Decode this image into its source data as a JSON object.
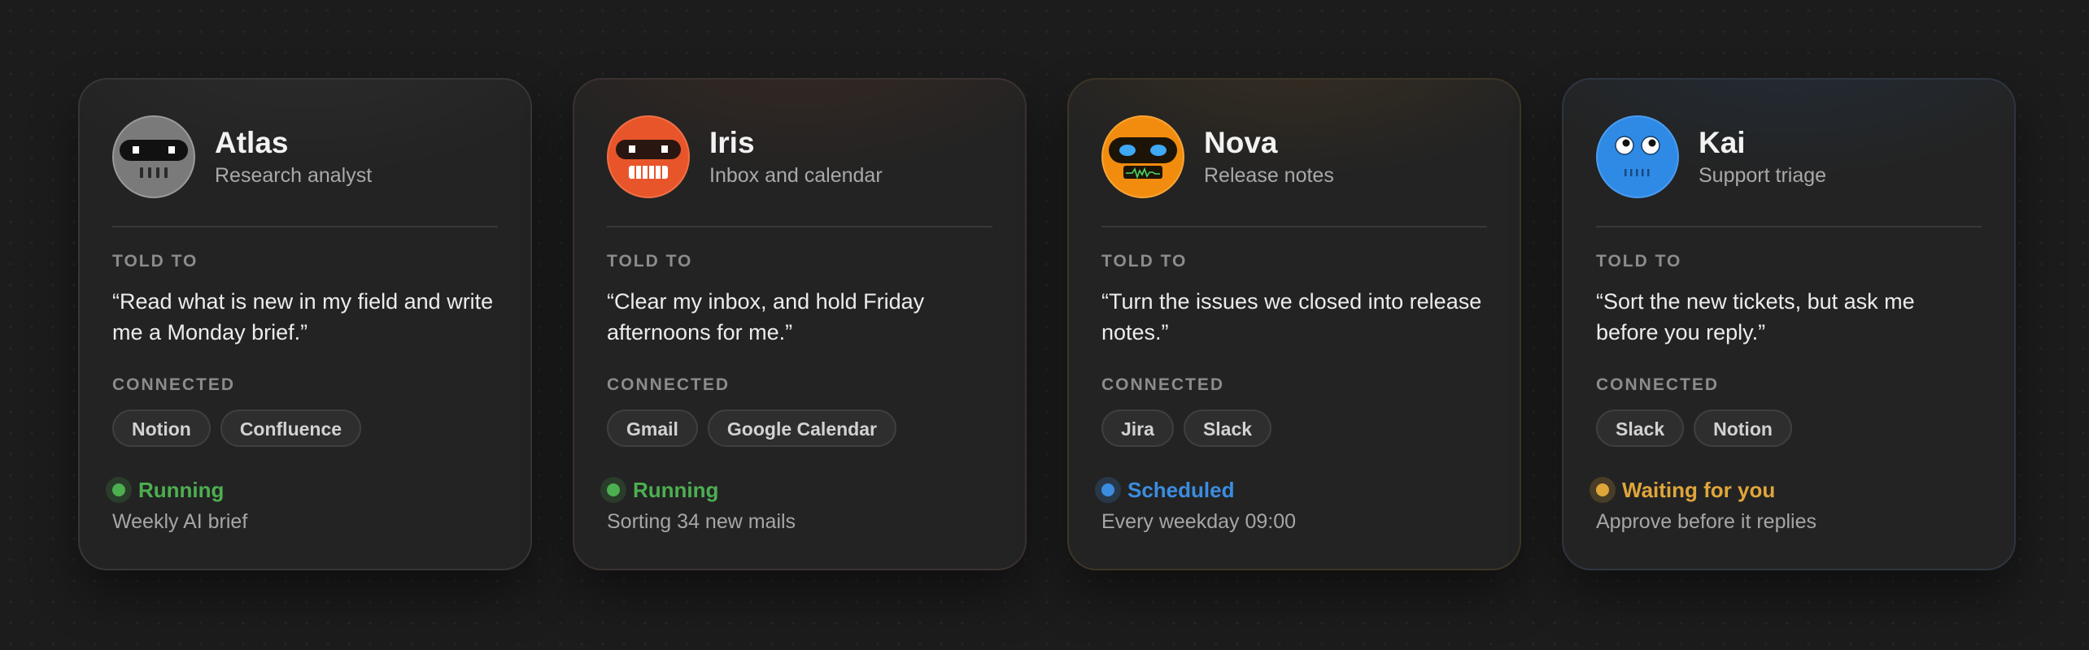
{
  "section_labels": {
    "told_to": "TOLD TO",
    "connected": "CONNECTED"
  },
  "agents": [
    {
      "name": "Atlas",
      "role": "Research analyst",
      "avatar": {
        "icon": "robot-visor-icon",
        "color": "#7a7a7a"
      },
      "instruction": "“Read what is new in my field and write me a Monday brief.”",
      "connected": [
        "Notion",
        "Confluence"
      ],
      "status": {
        "label": "Running",
        "color": "#4caf50"
      },
      "detail": "Weekly AI brief"
    },
    {
      "name": "Iris",
      "role": "Inbox and calendar",
      "avatar": {
        "icon": "robot-grin-icon",
        "color": "#e8552a"
      },
      "instruction": "“Clear my inbox, and hold Friday afternoons for me.”",
      "connected": [
        "Gmail",
        "Google Calendar"
      ],
      "status": {
        "label": "Running",
        "color": "#4caf50"
      },
      "detail": "Sorting 34 new mails"
    },
    {
      "name": "Nova",
      "role": "Release notes",
      "avatar": {
        "icon": "robot-pulse-icon",
        "color": "#f28c0f"
      },
      "instruction": "“Turn the issues we closed into release notes.”",
      "connected": [
        "Jira",
        "Slack"
      ],
      "status": {
        "label": "Scheduled",
        "color": "#3b8de0"
      },
      "detail": "Every weekday 09:00"
    },
    {
      "name": "Kai",
      "role": "Support triage",
      "avatar": {
        "icon": "robot-googly-eyes-icon",
        "color": "#2f8ae6"
      },
      "instruction": "“Sort the new tickets, but ask me before you reply.”",
      "connected": [
        "Slack",
        "Notion"
      ],
      "status": {
        "label": "Waiting for you",
        "color": "#e0a63a"
      },
      "detail": "Approve before it replies"
    }
  ]
}
